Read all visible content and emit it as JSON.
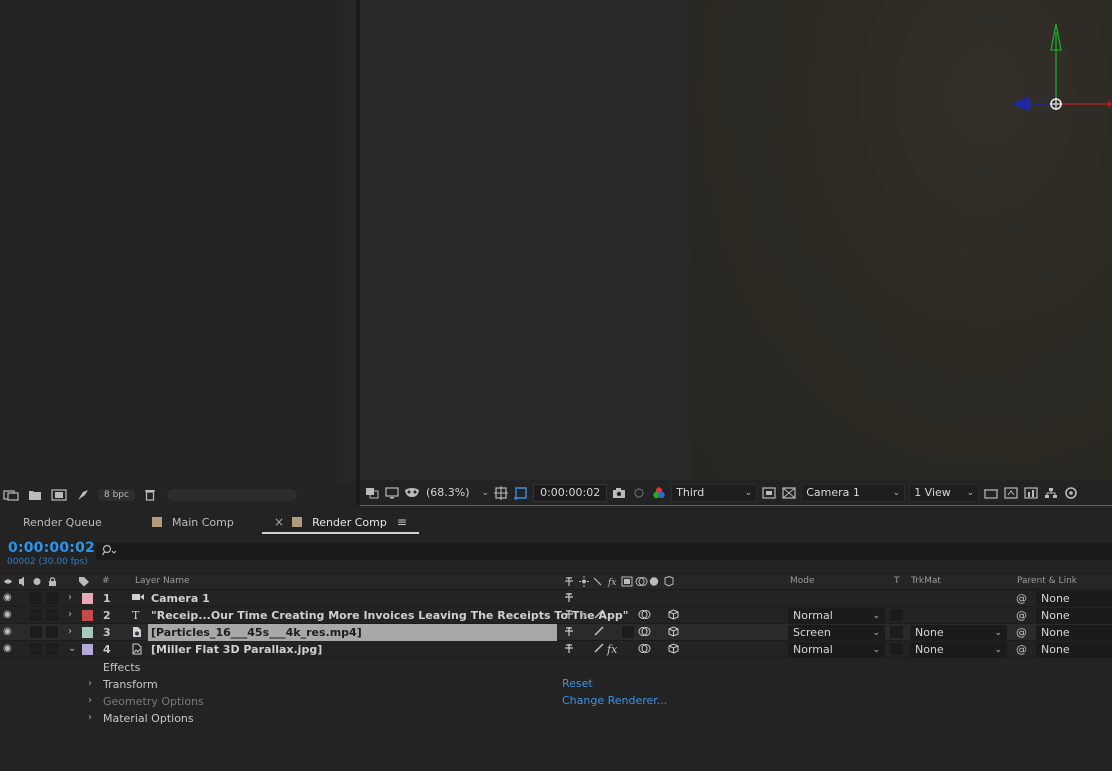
{
  "project": {
    "bpc": "8 bpc"
  },
  "viewer_toolbar": {
    "zoom": "(68.3%)",
    "timecode": "0:00:00:02",
    "renderer_view": "Third",
    "camera": "Camera 1",
    "views": "1 View"
  },
  "tabs": [
    {
      "label": "Render Queue",
      "swatch": ""
    },
    {
      "label": "Main Comp",
      "swatch": "#b39a7a"
    },
    {
      "label": "Render Comp",
      "swatch": "#b39a7a",
      "active": true
    }
  ],
  "timeline": {
    "timecode": "0:00:00:02",
    "frame_info": "00002 (30.00 fps)",
    "search_placeholder": "",
    "headers": {
      "num": "#",
      "layer_name": "Layer Name",
      "mode": "Mode",
      "t": "T",
      "trkmat": "TrkMat",
      "parent": "Parent & Link"
    },
    "layers": [
      {
        "num": "1",
        "name": "Camera 1",
        "color": "#e6a9b4",
        "type": "camera",
        "mode": "",
        "trkmat": "",
        "parent": "None"
      },
      {
        "num": "2",
        "name": "\"Receip...Our  Time   Creating More Invoices Leaving The Receipts To The App\"",
        "color": "#c44b4b",
        "type": "text",
        "mode": "Normal",
        "trkmat": "",
        "parent": "None"
      },
      {
        "num": "3",
        "name": "[Particles_16___45s___4k_res.mp4]",
        "color": "#a7c9b9",
        "type": "footage",
        "mode": "Screen",
        "trkmat": "None",
        "parent": "None"
      },
      {
        "num": "4",
        "name": "[Miller Flat 3D Parallax.jpg]",
        "color": "#b4a9d6",
        "type": "image",
        "mode": "Normal",
        "trkmat": "None",
        "parent": "None"
      }
    ],
    "properties": [
      {
        "label": "Effects",
        "link": ""
      },
      {
        "label": "Transform",
        "link": "Reset"
      },
      {
        "label": "Geometry Options",
        "link": "Change Renderer...",
        "dim": true
      },
      {
        "label": "Material Options",
        "link": ""
      }
    ]
  }
}
